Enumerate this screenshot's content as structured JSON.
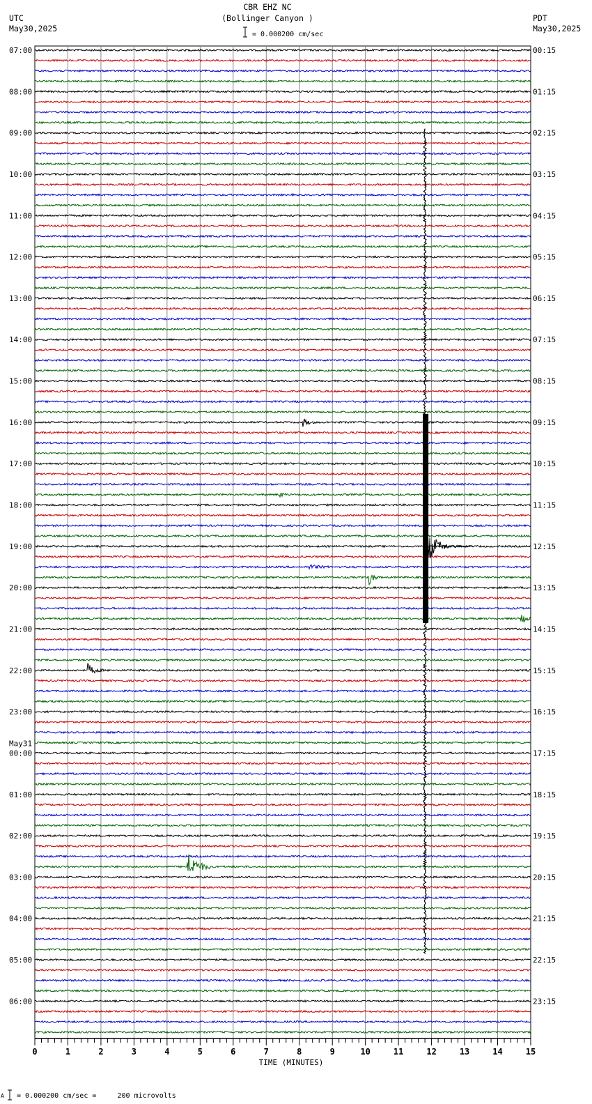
{
  "header": {
    "station": "CBR EHZ NC",
    "site": "(Bollinger Canyon )",
    "scale": "= 0.000200 cm/sec",
    "left_tz": "UTC",
    "left_date": "May30,2025",
    "right_tz": "PDT",
    "right_date": "May30,2025"
  },
  "footer": {
    "scale_note": "= 0.000200 cm/sec =     200 microvolts",
    "marker": "A"
  },
  "chart_data": {
    "type": "line",
    "title": "CBR EHZ NC (Bollinger Canyon )",
    "xlabel": "TIME (MINUTES)",
    "xlim": [
      0,
      15
    ],
    "x_ticks": [
      "0",
      "1",
      "2",
      "3",
      "4",
      "5",
      "6",
      "7",
      "8",
      "9",
      "10",
      "11",
      "12",
      "13",
      "14",
      "15"
    ],
    "grid": true,
    "traces_per_hour": 4,
    "trace_colors": [
      "#000000",
      "#cc0000",
      "#0000cc",
      "#006600"
    ],
    "left_labels": [
      "07:00",
      "08:00",
      "09:00",
      "10:00",
      "11:00",
      "12:00",
      "13:00",
      "14:00",
      "15:00",
      "16:00",
      "17:00",
      "18:00",
      "19:00",
      "20:00",
      "21:00",
      "22:00",
      "23:00",
      "00:00",
      "01:00",
      "02:00",
      "03:00",
      "04:00",
      "05:00",
      "06:00"
    ],
    "date_change_label": {
      "hour_index": 17,
      "text": "May31"
    },
    "right_labels": [
      "00:15",
      "01:15",
      "02:15",
      "03:15",
      "04:15",
      "05:15",
      "06:15",
      "07:15",
      "08:15",
      "09:15",
      "10:15",
      "11:15",
      "12:15",
      "13:15",
      "14:15",
      "15:15",
      "16:15",
      "17:15",
      "18:15",
      "19:15",
      "20:15",
      "21:15",
      "22:15",
      "23:15"
    ],
    "events": [
      {
        "trace": 36,
        "minute": 8.1,
        "amplitude": 6,
        "duration": 0.4
      },
      {
        "trace": 43,
        "minute": 7.4,
        "amplitude": 4,
        "duration": 0.3
      },
      {
        "trace": 50,
        "minute": 8.3,
        "amplitude": 3,
        "duration": 0.8
      },
      {
        "trace": 51,
        "minute": 10.1,
        "amplitude": 14,
        "duration": 0.3
      },
      {
        "trace": 55,
        "minute": 14.7,
        "amplitude": 5,
        "duration": 0.6
      },
      {
        "trace": 60,
        "minute": 1.6,
        "amplitude": 9,
        "duration": 0.5
      },
      {
        "trace": 79,
        "minute": 4.6,
        "amplitude": 22,
        "duration": 0.8
      },
      {
        "trace": 48,
        "minute": 11.8,
        "amplitude": 40,
        "duration": 1.2
      }
    ],
    "large_quake": {
      "minute": 11.8,
      "first_trace": 8,
      "last_trace": 87,
      "peak_trace": 48
    }
  }
}
